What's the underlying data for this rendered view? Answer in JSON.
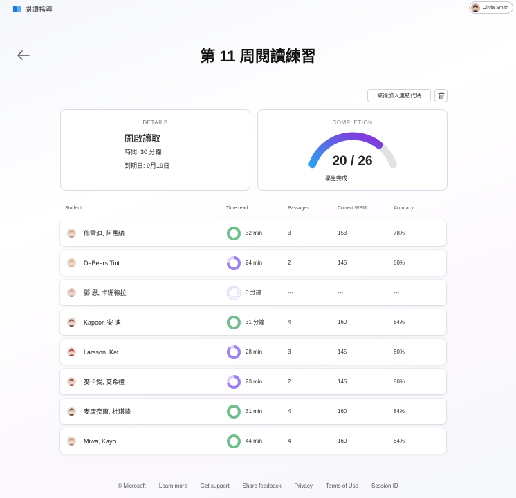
{
  "app": {
    "name": "閱讀指導",
    "icon": "book-icon"
  },
  "user": {
    "name": "Olivia Smith"
  },
  "page": {
    "title": "第 11 周閱讀練習"
  },
  "toolbar": {
    "join_code_label": "取得加入連結代碼",
    "delete_icon": "trash-icon"
  },
  "details": {
    "label": "DETAILS",
    "title": "開啟讀取",
    "time": "時間: 30 分鐘",
    "due": "到期日: 9月19日"
  },
  "completion": {
    "label": "COMPLETION",
    "value_text": "20 / 26",
    "completed": 20,
    "total": 26,
    "caption": "學生完成"
  },
  "table": {
    "headers": {
      "student": "Student",
      "time_read": "Time read",
      "passages": "Passages",
      "wpm": "Correct WPM",
      "accuracy": "Accuracy"
    },
    "rows": [
      {
        "name": "佈雷迪, 阿馬納",
        "time": "32 min",
        "passages": "3",
        "wpm": "153",
        "accuracy": "78%",
        "progress": 1.0,
        "ring_color": "#6fbf8c",
        "avatar_color": "#c79a7a"
      },
      {
        "name": "DeBeers Tint",
        "time": "24 min",
        "passages": "2",
        "wpm": "145",
        "accuracy": "80%",
        "progress": 0.75,
        "ring_color": "#9b82f0",
        "avatar_color": "#e0b080"
      },
      {
        "name": "鄧 恩, 卡珊德拉",
        "time": "0 分鐘",
        "passages": "---",
        "wpm": "---",
        "accuracy": "---",
        "progress": 0,
        "ring_color": "#9b82f0",
        "avatar_color": "#c98c9a"
      },
      {
        "name": "Kapoor, 安 迪",
        "time": "31 分鐘",
        "passages": "4",
        "wpm": "160",
        "accuracy": "84%",
        "progress": 1.0,
        "ring_color": "#6fbf8c",
        "avatar_color": "#7a5040"
      },
      {
        "name": "Larsson, Kat",
        "time": "28 min",
        "passages": "3",
        "wpm": "145",
        "accuracy": "80%",
        "progress": 0.88,
        "ring_color": "#9b82f0",
        "avatar_color": "#b03040"
      },
      {
        "name": "麥卡錫, 艾希禮",
        "time": "23 min",
        "passages": "2",
        "wpm": "145",
        "accuracy": "80%",
        "progress": 0.72,
        "ring_color": "#9b82f0",
        "avatar_color": "#8a4a3a"
      },
      {
        "name": "麥康奈爾, 杜琪峰",
        "time": "31 min",
        "passages": "4",
        "wpm": "160",
        "accuracy": "84%",
        "progress": 1.0,
        "ring_color": "#6fbf8c",
        "avatar_color": "#6a5040"
      },
      {
        "name": "Miwa, Kayo",
        "time": "44 min",
        "passages": "4",
        "wpm": "160",
        "accuracy": "84%",
        "progress": 1.0,
        "ring_color": "#6fbf8c",
        "avatar_color": "#c08a80"
      }
    ]
  },
  "footer": {
    "links": [
      "© Microsoft",
      "Learn more",
      "Get support",
      "Share feedback",
      "Privacy",
      "Terms of Use",
      "Session ID"
    ]
  },
  "colors": {
    "gauge_start": "#2f9ef0",
    "gauge_end": "#8a2fd8",
    "gauge_track": "#e2e2e6"
  }
}
